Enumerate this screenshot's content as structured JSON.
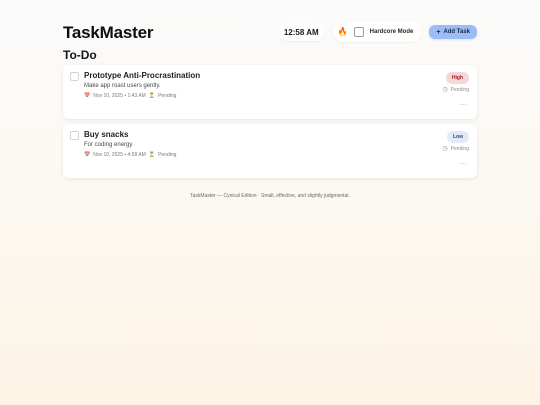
{
  "app": {
    "title": "TaskMaster"
  },
  "header": {
    "time": "12:58 AM",
    "hardcore_mode_label": "Hardcore Mode",
    "add_task_label": "Add Task"
  },
  "section": {
    "title": "To-Do"
  },
  "tasks": [
    {
      "title": "Prototype Anti-Procrastination",
      "description": "Make app roast users gently.",
      "date": "Nov 10, 2025 • 1:43 AM",
      "status": "Pending",
      "priority": "High",
      "side_status": "Pending"
    },
    {
      "title": "Buy snacks",
      "description": "For coding energy",
      "date": "Nov 10, 2025 • 4:58 AM",
      "status": "Pending",
      "priority": "Low",
      "side_status": "Pending"
    }
  ],
  "footer": {
    "text": "TaskMaster — Cynical Edition · Small, effective, and slightly judgmental."
  },
  "icons": {
    "fire": "fire-icon",
    "checkbox": "checkbox-icon",
    "plus": "plus-icon",
    "calendar": "calendar-icon",
    "hourglass": "hourglass-icon",
    "status": "status-icon",
    "more": "more-icon"
  },
  "colors": {
    "add_task_button": "#9cbcf5",
    "high_badge_bg": "#f6d7d7",
    "high_badge_text": "#9b1c1c",
    "low_badge_bg": "#e2eaf8",
    "low_badge_text": "#234a8f"
  }
}
